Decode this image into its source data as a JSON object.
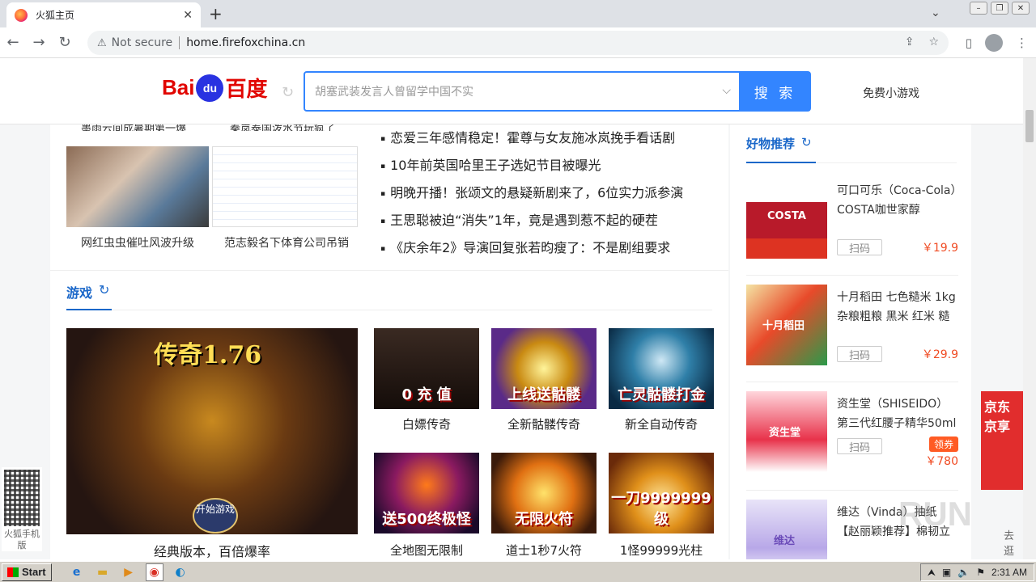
{
  "browser": {
    "tab_title": "火狐主页",
    "tab_close": "✕",
    "new_tab": "+",
    "tab_menu": "⌄",
    "not_secure": "Not secure",
    "url": "home.firefoxchina.cn",
    "nav": {
      "back": "←",
      "forward": "→",
      "reload": "↻"
    },
    "icons": {
      "share": "⇪",
      "star": "☆",
      "sidebar": "▯",
      "menu": "⋮"
    }
  },
  "header": {
    "logo_bai": "Bai",
    "logo_du": "du",
    "logo_cn": "百度",
    "search_placeholder": "胡塞武装发言人曾留学中国不实",
    "search_button": "搜 索",
    "games_link": "免费小游戏"
  },
  "news": {
    "top_captions": [
      "墨雨云间成暑期第一爆",
      "秦岚泰国泼水节玩疯了"
    ],
    "captions": [
      "网红虫虫催吐风波升级",
      "范志毅名下体育公司吊销"
    ],
    "headlines": [
      "恋爱三年感情稳定！霍尊与女友施冰岚挽手看话剧",
      "10年前英国哈里王子选妃节目被曝光",
      "明晚开播！张颂文的悬疑新剧来了，6位实力派参演",
      "王思聪被迫“消失”1年，竟是遇到惹不起的硬茬",
      "《庆余年2》导演回复张若昀瘦了：不是剧组要求"
    ]
  },
  "games": {
    "title": "游戏",
    "big": {
      "image_text": "传奇1.76",
      "badge": "开始游戏",
      "caption": "经典版本，百倍爆率"
    },
    "tiles": [
      {
        "image_text": "0 充 值",
        "caption": "白嫖传奇"
      },
      {
        "image_text": "上线送骷髅",
        "caption": "全新骷髅传奇"
      },
      {
        "image_text": "亡灵骷髅打金",
        "caption": "新全自动传奇"
      },
      {
        "image_text": "送500终极怪",
        "caption": "全地图无限制"
      },
      {
        "image_text": "无限火符",
        "caption": "道士1秒7火符"
      },
      {
        "image_text": "一刀9999999级",
        "caption": "1怪99999光柱"
      }
    ]
  },
  "products": {
    "title": "好物推荐",
    "scan_label": "扫码",
    "items": [
      {
        "name": "可口可乐（Coca-Cola）COSTA咖世家醇",
        "price": "￥19.9",
        "image_text": "COSTA"
      },
      {
        "name": "十月稻田 七色糙米 1kg 杂粮粗粮 黑米 红米 糙",
        "price": "￥29.9",
        "image_text": "十月稻田"
      },
      {
        "name": "资生堂（SHISEIDO）第三代红腰子精华50ml",
        "price": "￥780",
        "coupon": "领券",
        "image_text": "资生堂"
      },
      {
        "name": "维达（Vinda）抽纸【赵丽颖推荐】棉韧立",
        "price": "",
        "image_text": "维达"
      }
    ]
  },
  "float": {
    "qr_label": "火狐手机版",
    "jd_text": "京东京享",
    "go_text": "去逛",
    "watermark": "RUN"
  },
  "taskbar": {
    "start": "Start",
    "time": "2:31 AM"
  }
}
